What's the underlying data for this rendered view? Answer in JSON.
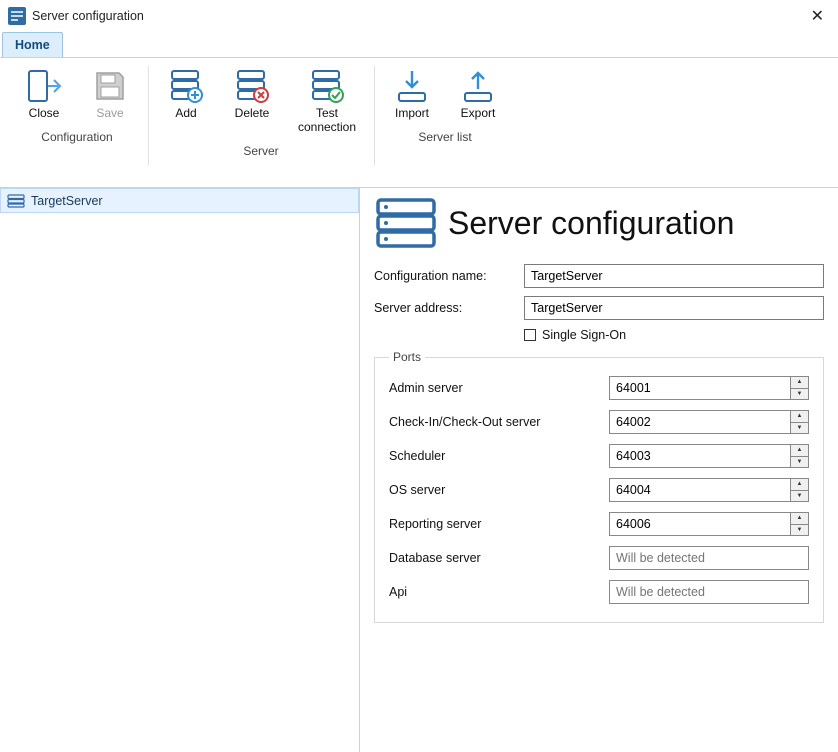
{
  "title_bar": {
    "title": "Server configuration"
  },
  "tabs": {
    "home": "Home"
  },
  "ribbon": {
    "groups": {
      "configuration": {
        "title": "Configuration",
        "close": "Close",
        "save": "Save"
      },
      "server": {
        "title": "Server",
        "add": "Add",
        "delete": "Delete",
        "test": "Test connection"
      },
      "server_list": {
        "title": "Server list",
        "import": "Import",
        "export": "Export"
      }
    }
  },
  "sidebar": {
    "items": [
      {
        "label": "TargetServer"
      }
    ]
  },
  "details": {
    "header": "Server configuration",
    "config_name_label": "Configuration name:",
    "config_name_value": "TargetServer",
    "server_addr_label": "Server address:",
    "server_addr_value": "TargetServer",
    "sso_label": "Single Sign-On",
    "sso_checked": false
  },
  "ports": {
    "legend": "Ports",
    "rows": [
      {
        "label": "Admin server",
        "value": "64001",
        "readonly": false
      },
      {
        "label": "Check-In/Check-Out server",
        "value": "64002",
        "readonly": false
      },
      {
        "label": "Scheduler",
        "value": "64003",
        "readonly": false
      },
      {
        "label": "OS server",
        "value": "64004",
        "readonly": false
      },
      {
        "label": "Reporting server",
        "value": "64006",
        "readonly": false
      },
      {
        "label": "Database server",
        "value": "",
        "readonly": true,
        "placeholder": "Will be detected"
      },
      {
        "label": "Api",
        "value": "",
        "readonly": true,
        "placeholder": "Will be detected"
      }
    ]
  }
}
